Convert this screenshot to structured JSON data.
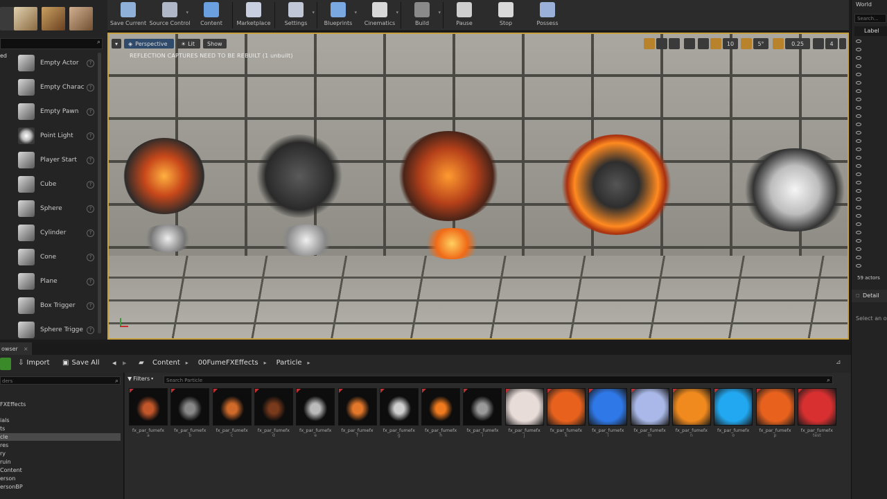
{
  "toolbar": {
    "buttons": [
      {
        "label": "Save Current"
      },
      {
        "label": "Source Control"
      },
      {
        "label": "Content"
      },
      {
        "label": "Marketplace"
      },
      {
        "label": "Settings"
      },
      {
        "label": "Blueprints"
      },
      {
        "label": "Cinematics"
      },
      {
        "label": "Build"
      },
      {
        "label": "Pause"
      },
      {
        "label": "Stop"
      },
      {
        "label": "Possess"
      }
    ]
  },
  "place_panel": {
    "items": [
      {
        "label": "Empty Actor",
        "icon": "sphere-icon"
      },
      {
        "label": "Empty Charac",
        "icon": "character-icon"
      },
      {
        "label": "Empty Pawn",
        "icon": "pawn-icon"
      },
      {
        "label": "Point Light",
        "icon": "light-bulb-icon"
      },
      {
        "label": "Player Start",
        "icon": "player-start-icon"
      },
      {
        "label": "Cube",
        "icon": "cube-icon"
      },
      {
        "label": "Sphere",
        "icon": "sphere-icon"
      },
      {
        "label": "Cylinder",
        "icon": "cylinder-icon"
      },
      {
        "label": "Cone",
        "icon": "cone-icon"
      },
      {
        "label": "Plane",
        "icon": "plane-icon"
      },
      {
        "label": "Box Trigger",
        "icon": "box-trigger-icon"
      },
      {
        "label": "Sphere Trigge",
        "icon": "sphere-trigger-icon"
      }
    ],
    "help_glyph": "?"
  },
  "viewport": {
    "perspective_label": "Perspective",
    "lit_label": "Lit",
    "show_label": "Show",
    "warning": "REFLECTION CAPTURES NEED TO BE REBUILT (1 unbuilt)",
    "grid_snap": "10",
    "rotation_snap": "5°",
    "scale_snap": "0.25",
    "camera_speed": "4"
  },
  "outliner": {
    "title": "World",
    "search_placeholder": "Search...",
    "column_label": "Label",
    "actor_count": "59 actors",
    "details_title": "Detail",
    "details_hint": "Select an o"
  },
  "content_browser": {
    "tab_label": "owser",
    "add_new_label": "",
    "import_label": "Import",
    "save_all_label": "Save All",
    "breadcrumb": [
      "Content",
      "00FumeFXEffects",
      "Particle"
    ],
    "folder_search_placeholder": "ders",
    "filters_label": "Filters",
    "search_placeholder": "Search Particle",
    "folders": [
      {
        "label": "FXEffects"
      },
      {
        "label": "ials"
      },
      {
        "label": "ts"
      },
      {
        "label": "cle",
        "selected": true
      },
      {
        "label": "res"
      },
      {
        "label": "ry"
      },
      {
        "label": "ruin"
      },
      {
        "label": "Content"
      },
      {
        "label": "erson"
      },
      {
        "label": "ersonBP"
      }
    ],
    "assets": [
      {
        "label": "fx_par_fumefx",
        "sub": "a",
        "color": "#c4572a"
      },
      {
        "label": "fx_par_fumefx",
        "sub": "b",
        "color": "#888888"
      },
      {
        "label": "fx_par_fumefx",
        "sub": "c",
        "color": "#d06a2a"
      },
      {
        "label": "fx_par_fumefx",
        "sub": "d",
        "color": "#7a3a1c"
      },
      {
        "label": "fx_par_fumefx",
        "sub": "e",
        "color": "#bbbbbb"
      },
      {
        "label": "fx_par_fumefx",
        "sub": "f",
        "color": "#e4782a"
      },
      {
        "label": "fx_par_fumefx",
        "sub": "g",
        "color": "#cfcfcf"
      },
      {
        "label": "fx_par_fumefx",
        "sub": "h",
        "color": "#f07a1e"
      },
      {
        "label": "fx_par_fumefx",
        "sub": "i",
        "color": "#9a9a9a"
      },
      {
        "label": "fx_par_fumefx",
        "sub": "j",
        "color": "#e8dcd8"
      },
      {
        "label": "fx_par_fumefx",
        "sub": "k",
        "color": "#e8621e"
      },
      {
        "label": "fx_par_fumefx",
        "sub": "l",
        "color": "#2f78e8"
      },
      {
        "label": "fx_par_fumefx",
        "sub": "m",
        "color": "#a9b8e8"
      },
      {
        "label": "fx_par_fumefx",
        "sub": "n",
        "color": "#f08a1e"
      },
      {
        "label": "fx_par_fumefx",
        "sub": "o",
        "color": "#22a8f0"
      },
      {
        "label": "fx_par_fumefx",
        "sub": "p",
        "color": "#e8621e"
      },
      {
        "label": "fx_par_fumefx",
        "sub": "test",
        "color": "#d83030"
      }
    ]
  },
  "colors": {
    "viewport_border": "#c7a13d",
    "accent_green": "#3a8a2a"
  }
}
